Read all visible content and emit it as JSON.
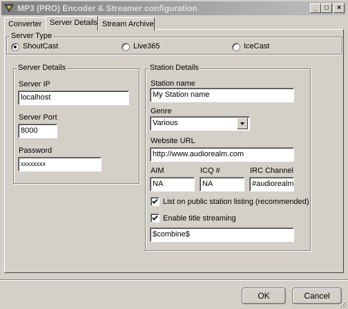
{
  "window": {
    "title": "MP3 (PRO) Encoder & Streamer configuration",
    "minimize_glyph": "_",
    "maximize_glyph": "□",
    "close_glyph": "×"
  },
  "tabs": [
    {
      "label": "Converter",
      "active": false
    },
    {
      "label": "Server Details",
      "active": true
    },
    {
      "label": "Stream Archive",
      "active": false
    }
  ],
  "server_type": {
    "label": "Server Type",
    "options": [
      {
        "label": "ShoutCast",
        "checked": true
      },
      {
        "label": "Live365",
        "checked": false
      },
      {
        "label": "IceCast",
        "checked": false
      }
    ]
  },
  "server_details": {
    "label": "Server Details",
    "ip_label": "Server IP",
    "ip_value": "localhost",
    "port_label": "Server Port",
    "port_value": "8000",
    "password_label": "Password",
    "password_value": "xxxxxxxx"
  },
  "station_details": {
    "label": "Station Details",
    "name_label": "Station name",
    "name_value": "My Station name",
    "genre_label": "Genre",
    "genre_value": "Various",
    "url_label": "Website URL",
    "url_value": "http://www.audiorealm.com",
    "aim_label": "AIM",
    "aim_value": "NA",
    "icq_label": "ICQ #",
    "icq_value": "NA",
    "irc_label": "IRC Channel",
    "irc_value": "#audiorealm",
    "list_public_label": "List on public station listing (recommended)",
    "list_public_checked": true,
    "title_streaming_label": "Enable title streaming",
    "title_streaming_checked": true,
    "title_format_value": "$combine$"
  },
  "buttons": {
    "ok": "OK",
    "cancel": "Cancel"
  }
}
